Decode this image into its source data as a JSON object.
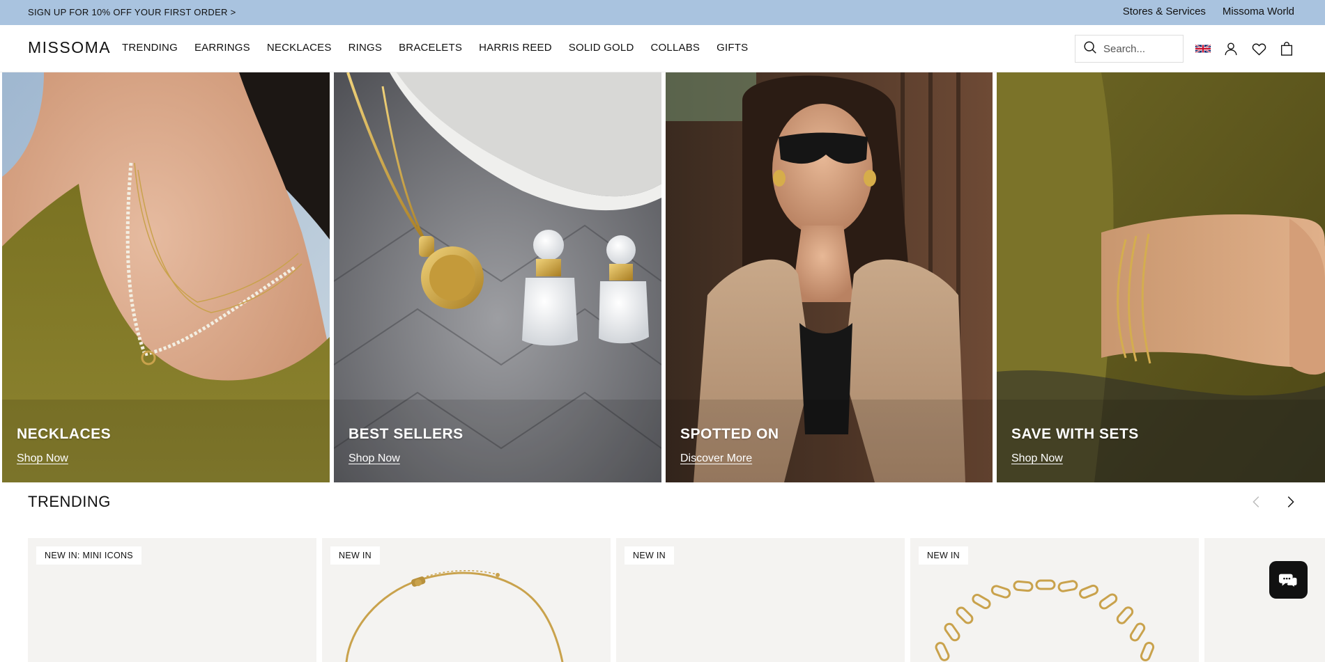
{
  "promo": {
    "text": "SIGN UP FOR 10% OFF YOUR FIRST ORDER >",
    "links": [
      "Stores & Services",
      "Missoma World"
    ]
  },
  "header": {
    "logo": "MISSOMA",
    "nav": [
      "TRENDING",
      "EARRINGS",
      "NECKLACES",
      "RINGS",
      "BRACELETS",
      "HARRIS REED",
      "SOLID GOLD",
      "COLLABS",
      "GIFTS"
    ],
    "search_placeholder": "Search...",
    "icons": [
      "uk-flag-icon",
      "account-icon",
      "wishlist-heart-icon",
      "shopping-bag-icon"
    ]
  },
  "tiles": [
    {
      "title": "NECKLACES",
      "link": "Shop Now"
    },
    {
      "title": "BEST SELLERS",
      "link": "Shop Now"
    },
    {
      "title": "SPOTTED ON",
      "link": "Discover More"
    },
    {
      "title": "SAVE WITH SETS",
      "link": "Shop Now"
    }
  ],
  "trending": {
    "title": "TRENDING",
    "cards": [
      {
        "badge": "NEW IN: MINI ICONS"
      },
      {
        "badge": "NEW IN"
      },
      {
        "badge": "NEW IN"
      },
      {
        "badge": "NEW IN"
      }
    ]
  },
  "colors": {
    "promo_bg": "#a9c3df",
    "card_bg": "#f4f3f1",
    "chat_bg": "#111111"
  }
}
